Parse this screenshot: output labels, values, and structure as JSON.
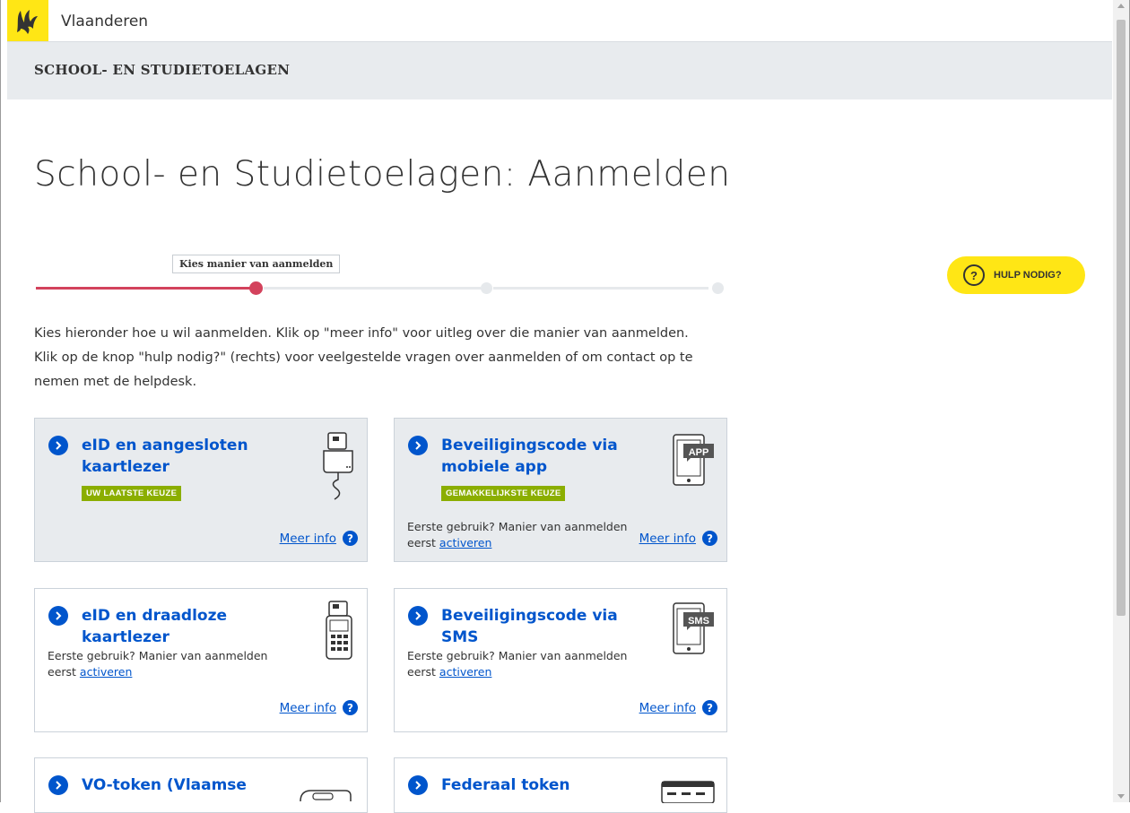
{
  "brand": {
    "name": "Vlaanderen"
  },
  "header": {
    "section": "SCHOOL- EN STUDIETOELAGEN"
  },
  "page": {
    "title": "School- en Studietoelagen: Aanmelden"
  },
  "steps": {
    "current_label": "Kies manier van aanmelden",
    "current": 1,
    "total": 3
  },
  "help": {
    "label": "HULP NODIG?",
    "icon_text": "?"
  },
  "intro": {
    "line1": "Kies hieronder hoe u wil aanmelden. Klik op \"meer info\" voor uitleg over die manier van aanmelden.",
    "line2": "Klik op de knop \"hulp nodig?\" (rechts) voor veelgestelde vragen over aanmelden of om contact op te",
    "line3": "nemen met de helpdesk."
  },
  "labels": {
    "more_info": "Meer info",
    "first_use": "Eerste gebruik? Manier van aanmelden eerst",
    "activate": "activeren"
  },
  "cards": [
    {
      "title": "eID en aangesloten kaartlezer",
      "badge": "UW LAATSTE KEUZE",
      "icon": "card-reader-icon"
    },
    {
      "title": "Beveiligingscode via mobiele app",
      "badge": "GEMAKKELIJKSTE KEUZE",
      "icon": "tablet-app-icon",
      "device_text": "APP"
    },
    {
      "title": "eID en draadloze kaartlezer",
      "icon": "wireless-reader-icon"
    },
    {
      "title": "Beveiligingscode via SMS",
      "icon": "tablet-sms-icon",
      "device_text": "SMS"
    },
    {
      "title": "VO-token (Vlaamse",
      "icon": "token-icon"
    },
    {
      "title": "Federaal token",
      "icon": "token-card-icon"
    }
  ],
  "colors": {
    "brand_yellow": "#ffe615",
    "link_blue": "#0055cc",
    "progress_red": "#d3425c",
    "badge_green": "#8bae00"
  }
}
